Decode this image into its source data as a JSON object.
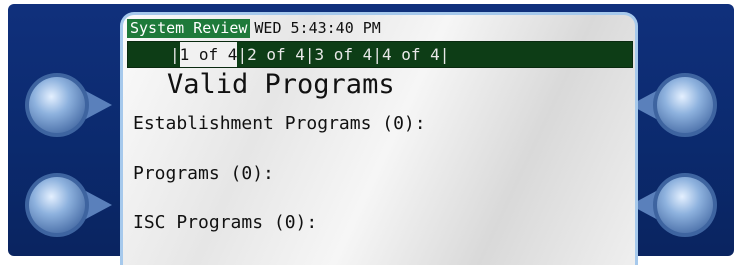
{
  "status": {
    "title": "System Review",
    "datetime": "WED 5:43:40 PM"
  },
  "pages": [
    {
      "label": "1 of 4",
      "active": true
    },
    {
      "label": "2 of 4",
      "active": false
    },
    {
      "label": "3 of 4",
      "active": false
    },
    {
      "label": "4 of 4",
      "active": false
    }
  ],
  "content": {
    "heading": "Valid Programs",
    "lines": [
      "Establishment Programs (0):",
      "Programs (0):",
      "ISC Programs (0):"
    ]
  },
  "colors": {
    "bezel": "#0b2a6e",
    "status_title_bg": "#1e7a3a",
    "page_bar_bg": "#0d3d16",
    "button_face": "#7fa7d6"
  }
}
